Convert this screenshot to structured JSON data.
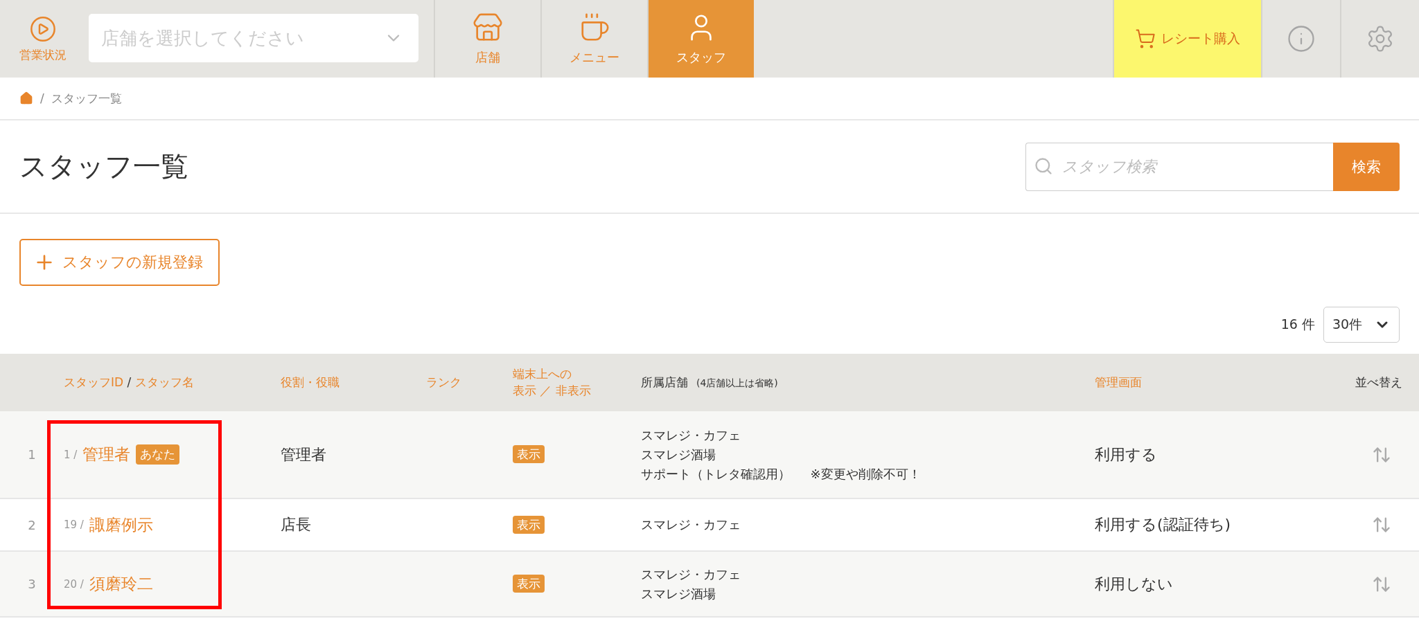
{
  "topbar": {
    "status": {
      "label": "営業状況"
    },
    "store_select": {
      "placeholder": "店舗を選択してください"
    },
    "nav": [
      {
        "label": "店舗",
        "selected": false
      },
      {
        "label": "メニュー",
        "selected": false
      },
      {
        "label": "スタッフ",
        "selected": true
      }
    ],
    "receipt_button": {
      "label": "レシート購入"
    }
  },
  "breadcrumb": {
    "separator": "/",
    "current": "スタッフ一覧"
  },
  "page_title": "スタッフ一覧",
  "search": {
    "placeholder": "スタッフ検索",
    "button": "検索"
  },
  "add_button": {
    "label": "スタッフの新規登録"
  },
  "count": "16 件",
  "per_page": {
    "value": "30件"
  },
  "table": {
    "columns": [
      {
        "kind": "blank"
      },
      {
        "kind": "staff",
        "parts": [
          "スタッフID",
          "/",
          "スタッフ名"
        ]
      },
      {
        "label": "役割・役職",
        "kind": "accent"
      },
      {
        "label": "ランク",
        "kind": "accent"
      },
      {
        "lines": [
          "端末上への",
          "表示 ／ 非表示"
        ],
        "kind": "twoline"
      },
      {
        "label": "所属店舗",
        "note": "(4店舗以上は省略)",
        "kind": "plain"
      },
      {
        "label": "管理画面",
        "kind": "accent"
      },
      {
        "label": "並べ替え",
        "kind": "plain"
      }
    ],
    "rows": [
      {
        "number": "1",
        "id": "1 /",
        "name": "管理者",
        "badge": "あなた",
        "role": "管理者",
        "display": "表示",
        "stores": [
          {
            "name": "スマレジ・カフェ"
          },
          {
            "name": "スマレジ酒場"
          },
          {
            "name": "サポート（トレタ確認用）",
            "note": "※変更や削除不可！"
          }
        ],
        "admin": "利用する"
      },
      {
        "number": "2",
        "id": "19 /",
        "name": "諏磨例示",
        "role": "店長",
        "display": "表示",
        "stores": [
          {
            "name": "スマレジ・カフェ"
          }
        ],
        "admin": "利用する(認証待ち)"
      },
      {
        "number": "3",
        "id": "20 /",
        "name": "須磨玲二",
        "display": "表示",
        "stores": [
          {
            "name": "スマレジ・カフェ"
          },
          {
            "name": "スマレジ酒場"
          }
        ],
        "admin": "利用しない"
      }
    ]
  },
  "annotation": {
    "kind": "frame"
  }
}
